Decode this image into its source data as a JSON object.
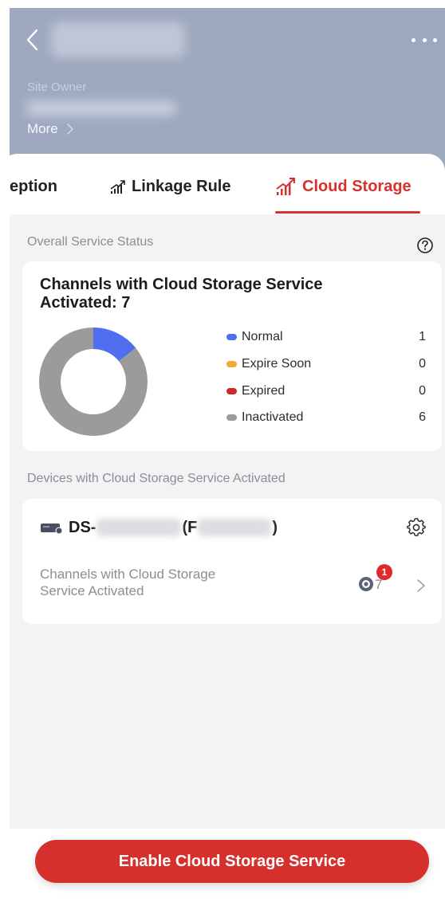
{
  "header": {
    "site_owner_label": "Site Owner",
    "more_label": "More"
  },
  "tabs": [
    {
      "label": "eption",
      "active": false
    },
    {
      "label": "Linkage Rule",
      "active": false
    },
    {
      "label": "Cloud Storage",
      "active": true
    }
  ],
  "overall": {
    "section_title": "Overall Service Status",
    "card_title": "Channels with Cloud Storage Service Activated: 7",
    "legend": [
      {
        "label": "Normal",
        "value": "1",
        "color": "#4f6ef0"
      },
      {
        "label": "Expire Soon",
        "value": "0",
        "color": "#f0a83c"
      },
      {
        "label": "Expired",
        "value": "0",
        "color": "#cf2a2a"
      },
      {
        "label": "Inactivated",
        "value": "6",
        "color": "#9b9b9b"
      }
    ]
  },
  "chart_data": {
    "type": "pie",
    "categories": [
      "Normal",
      "Expire Soon",
      "Expired",
      "Inactivated"
    ],
    "values": [
      1,
      0,
      0,
      6
    ],
    "colors": [
      "#4f6ef0",
      "#f0a83c",
      "#cf2a2a",
      "#9b9b9b"
    ],
    "donut": true
  },
  "devices": {
    "section_title": "Devices with Cloud Storage Service Activated",
    "device_prefix": "DS-",
    "device_mid": "(F",
    "device_suffix": ")",
    "channels_label": "Channels with Cloud Storage Service Activated",
    "channels_count": "7",
    "badge_count": "1"
  },
  "footer": {
    "enable_button": "Enable Cloud Storage Service"
  },
  "colors": {
    "accent": "#d5302c",
    "header_bg": "#9ea8bf",
    "page_bg": "#f3f3f5"
  }
}
